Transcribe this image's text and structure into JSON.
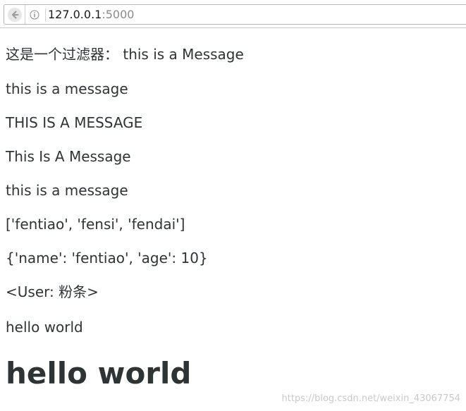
{
  "browser": {
    "url_host": "127.0.0.1",
    "url_port": ":5000"
  },
  "page": {
    "lines": [
      "这是一个过滤器： this is a Message",
      "this is a message",
      "THIS IS A MESSAGE",
      "This Is A Message",
      "this is a message",
      "['fentiao', 'fensi', 'fendai']",
      "{'name': 'fentiao', 'age': 10}",
      "<User: 粉条>",
      "hello world"
    ],
    "heading": "hello world"
  },
  "watermark": "https://blog.csdn.net/weixin_43067754"
}
